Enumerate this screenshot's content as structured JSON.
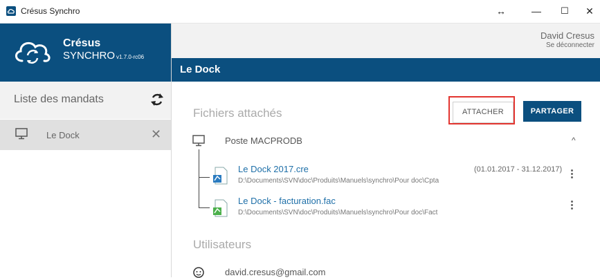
{
  "window": {
    "title": "Crésus Synchro",
    "resize_symbol": "↔",
    "minimize_symbol": "—",
    "maximize_symbol": "☐",
    "close_symbol": "✕"
  },
  "brand": {
    "name": "Crésus",
    "product": "SYNCHRO",
    "version": "v1.7.0-rc06"
  },
  "sidebar": {
    "list_title": "Liste des mandats",
    "items": [
      {
        "label": "Le Dock",
        "icon": "monitor-icon"
      }
    ]
  },
  "user": {
    "name": "David Cresus",
    "logout_label": "Se déconnecter"
  },
  "page": {
    "title": "Le Dock"
  },
  "files_section": {
    "title": "Fichiers attachés",
    "attach_label": "ATTACHER",
    "share_label": "PARTAGER",
    "poste": "Poste MACPRODB",
    "chevron": "^",
    "files": [
      {
        "name": "Le Dock 2017.cre",
        "path": "D:\\Documents\\SVN\\doc\\Produits\\Manuels\\synchro\\Pour doc\\Cpta",
        "period": "(01.01.2017 - 31.12.2017)"
      },
      {
        "name": "Le Dock - facturation.fac",
        "path": "D:\\Documents\\SVN\\doc\\Produits\\Manuels\\synchro\\Pour doc\\Fact",
        "period": ""
      }
    ]
  },
  "users_section": {
    "title": "Utilisateurs",
    "users": [
      {
        "email": "david.cresus@gmail.com"
      }
    ]
  },
  "colors": {
    "brand": "#0b4f7f",
    "highlight": "#e3342f",
    "link": "#1e6fa8"
  }
}
